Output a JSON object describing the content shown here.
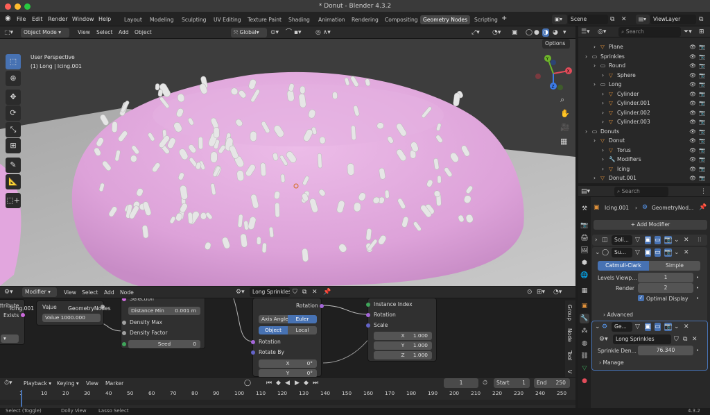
{
  "window": {
    "title": "* Donut - Blender 4.3.2"
  },
  "menu": {
    "items": [
      "File",
      "Edit",
      "Render",
      "Window",
      "Help"
    ]
  },
  "workspaces": [
    "Layout",
    "Modeling",
    "Sculpting",
    "UV Editing",
    "Texture Paint",
    "Shading",
    "Animation",
    "Rendering",
    "Compositing",
    "Geometry Nodes",
    "Scripting"
  ],
  "active_workspace": "Geometry Nodes",
  "scene": {
    "name": "Scene",
    "view_layer": "ViewLayer"
  },
  "viewport": {
    "mode": "Object Mode",
    "menus": [
      "View",
      "Select",
      "Add",
      "Object"
    ],
    "orientation": "Global",
    "options_label": "Options",
    "overlay_line1": "User Perspective",
    "overlay_line2": "(1) Long | Icing.001",
    "gizmo_axes": [
      "X",
      "Y",
      "Z"
    ]
  },
  "outliner": {
    "search_placeholder": "Search",
    "rows": [
      {
        "label": "Plane",
        "depth": 1
      },
      {
        "label": "Sprinkles",
        "depth": 0
      },
      {
        "label": "Round",
        "depth": 1
      },
      {
        "label": "Sphere",
        "depth": 2
      },
      {
        "label": "Long",
        "depth": 1
      },
      {
        "label": "Cylinder",
        "depth": 2
      },
      {
        "label": "Cylinder.001",
        "depth": 2
      },
      {
        "label": "Cylinder.002",
        "depth": 2
      },
      {
        "label": "Cylinder.003",
        "depth": 2
      },
      {
        "label": "Donuts",
        "depth": 0
      },
      {
        "label": "Donut",
        "depth": 1
      },
      {
        "label": "Torus",
        "depth": 2
      },
      {
        "label": "Modifiers",
        "depth": 2
      },
      {
        "label": "Icing",
        "depth": 2
      },
      {
        "label": "Donut.001",
        "depth": 1
      }
    ]
  },
  "properties": {
    "search_placeholder": "Search",
    "object_name": "Icing.001",
    "modifier_name": "GeometryNod...",
    "add_modifier": "Add Modifier",
    "modifiers": [
      {
        "name": "Soli..."
      },
      {
        "name": "Su..."
      },
      {
        "name": "Ge..."
      }
    ],
    "subsurf": {
      "mode_a": "Catmull-Clark",
      "mode_b": "Simple",
      "levels_label": "Levels Viewp...",
      "levels_value": "1",
      "render_label": "Render",
      "render_value": "2",
      "optimal_label": "Optimal Display",
      "advanced_label": "Advanced"
    },
    "geonodes": {
      "tree_name": "Long Sprinkles",
      "density_label": "Sprinkle Den...",
      "density_value": "76.340",
      "manage_label": "Manage"
    }
  },
  "node_editor": {
    "editor_type": "Modifier",
    "menus": [
      "View",
      "Select",
      "Add",
      "Node"
    ],
    "tree_name": "Long Sprinkles",
    "breadcrumb_obj": "Icing.001",
    "breadcrumb_mod": "GeometryNodes",
    "side_tabs": [
      "Group",
      "Node",
      "Tool",
      "V"
    ],
    "node_value_field": {
      "label": "Value",
      "value": "1000.000"
    },
    "node_attr": {
      "a": "ttribute",
      "b": "Exists"
    },
    "distribute": {
      "selection": "Selection",
      "distance_min_label": "Distance Min",
      "distance_min_value": "0.001 m",
      "density_max": "Density Max",
      "density_factor": "Density Factor",
      "seed_label": "Seed",
      "seed_value": "0"
    },
    "rotate": {
      "rotation_out": "Rotation",
      "axis_angle": "Axis Angle",
      "euler": "Euler",
      "object": "Object",
      "local": "Local",
      "rotation_in": "Rotation",
      "rotate_by": "Rotate By",
      "x_label": "X",
      "x_value": "0°",
      "y_label": "Y",
      "y_value": "0°"
    },
    "instance": {
      "instance_index": "Instance Index",
      "rotation": "Rotation",
      "scale": "Scale",
      "sx_label": "X",
      "sx": "1.000",
      "sy_label": "Y",
      "sy": "1.000",
      "sz_label": "Z",
      "sz": "1.000"
    }
  },
  "timeline": {
    "menus": [
      "Playback",
      "Keying",
      "View",
      "Marker"
    ],
    "current_frame": "1",
    "start_label": "Start",
    "start": "1",
    "end_label": "End",
    "end": "250",
    "ticks": [
      "1",
      "10",
      "20",
      "30",
      "40",
      "50",
      "60",
      "70",
      "80",
      "90",
      "100",
      "110",
      "120",
      "130",
      "140",
      "150",
      "160",
      "170",
      "180",
      "190",
      "200",
      "210",
      "220",
      "230",
      "240",
      "250"
    ]
  },
  "status": {
    "left": "Select (Toggle)",
    "middle": "Dolly View",
    "right": "Lasso Select",
    "version": "4.3.2"
  },
  "colors": {
    "accent": "#4772b3",
    "icing": "#e0a8dc",
    "sprinkle": "#e4e4e4",
    "mesh_icon": "#3ea95b",
    "object_icon": "#e0913a"
  }
}
